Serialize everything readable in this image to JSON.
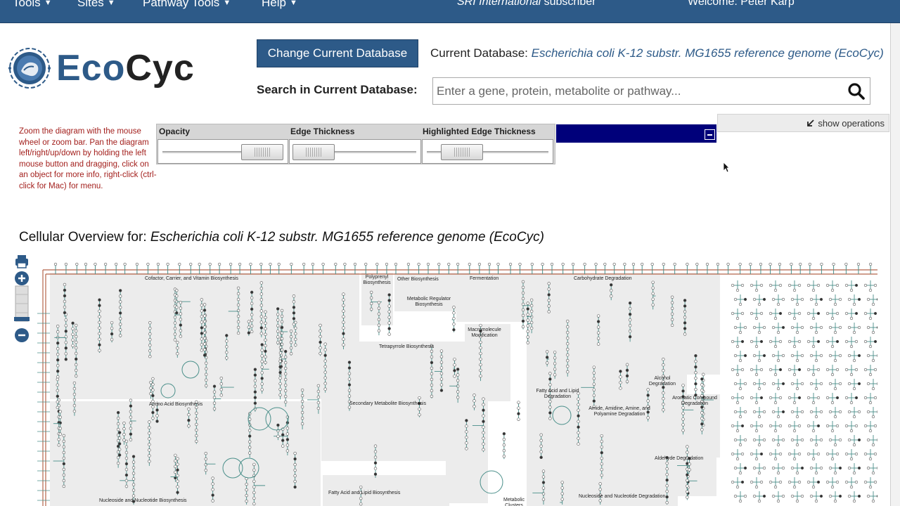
{
  "topnav": {
    "items": [
      {
        "label": "Tools"
      },
      {
        "label": "Sites"
      },
      {
        "label": "Pathway Tools"
      },
      {
        "label": "Help"
      }
    ],
    "subscriber_org": "SRI International",
    "subscriber_suffix": " subscriber",
    "welcome": "Welcome: Peter Karp"
  },
  "logo": {
    "text_eco": "Eco",
    "text_cyc": "Cyc"
  },
  "database": {
    "change_button": "Change Current Database",
    "current_label": "Current Database: ",
    "current_name": "Escherichia coli K-12 substr. MG1655 reference genome (EcoCyc)"
  },
  "search": {
    "label": "Search in Current Database:",
    "placeholder": "Enter a gene, protein, metabolite or pathway..."
  },
  "help_text": "Zoom the diagram with the mouse wheel or zoom bar. Pan the diagram left/right/up/down by holding the left mouse button and dragging, click on an object for more info, right-click (ctrl-click for Mac) for menu.",
  "sliders": [
    {
      "label": "Opacity"
    },
    {
      "label": "Edge Thickness"
    },
    {
      "label": "Highlighted Edge Thickness"
    }
  ],
  "show_operations": "show operations",
  "overview": {
    "title_prefix": "Cellular Overview for: ",
    "title_organism": "Escherichia coli K-12 substr. MG1655 reference genome (EcoCyc)"
  },
  "diagram": {
    "regions": [
      {
        "label": "Cofactor, Carrier, and Vitamin Biosynthesis"
      },
      {
        "label": "Polyprenyl Biosynthesis"
      },
      {
        "label": "Other Biosynthesis"
      },
      {
        "label": "Metabolic Regulator Biosynthesis"
      },
      {
        "label": "Fermentation"
      },
      {
        "label": "Carbohydrate Degradation"
      },
      {
        "label": "Macromolecule Modification"
      },
      {
        "label": "Tetrapyrrole Biosynthesis"
      },
      {
        "label": "Alcohol Degradation"
      },
      {
        "label": "Fatty Acid and Lipid Degradation"
      },
      {
        "label": "Aromatic Compound Degradation"
      },
      {
        "label": "Amino Acid Biosynthesis"
      },
      {
        "label": "Secondary Metabolite Biosynthesis"
      },
      {
        "label": "Amide, Amidine, Amine, and Polyamine Degradation"
      },
      {
        "label": "Aldehyde Degradation"
      },
      {
        "label": "Fatty Acid and Lipid Biosynthesis"
      },
      {
        "label": "Nucleoside and Nucleotide Biosynthesis"
      },
      {
        "label": "Metabolic Clusters"
      },
      {
        "label": "Nucleoside and Nucleotide Degradation"
      }
    ]
  }
}
